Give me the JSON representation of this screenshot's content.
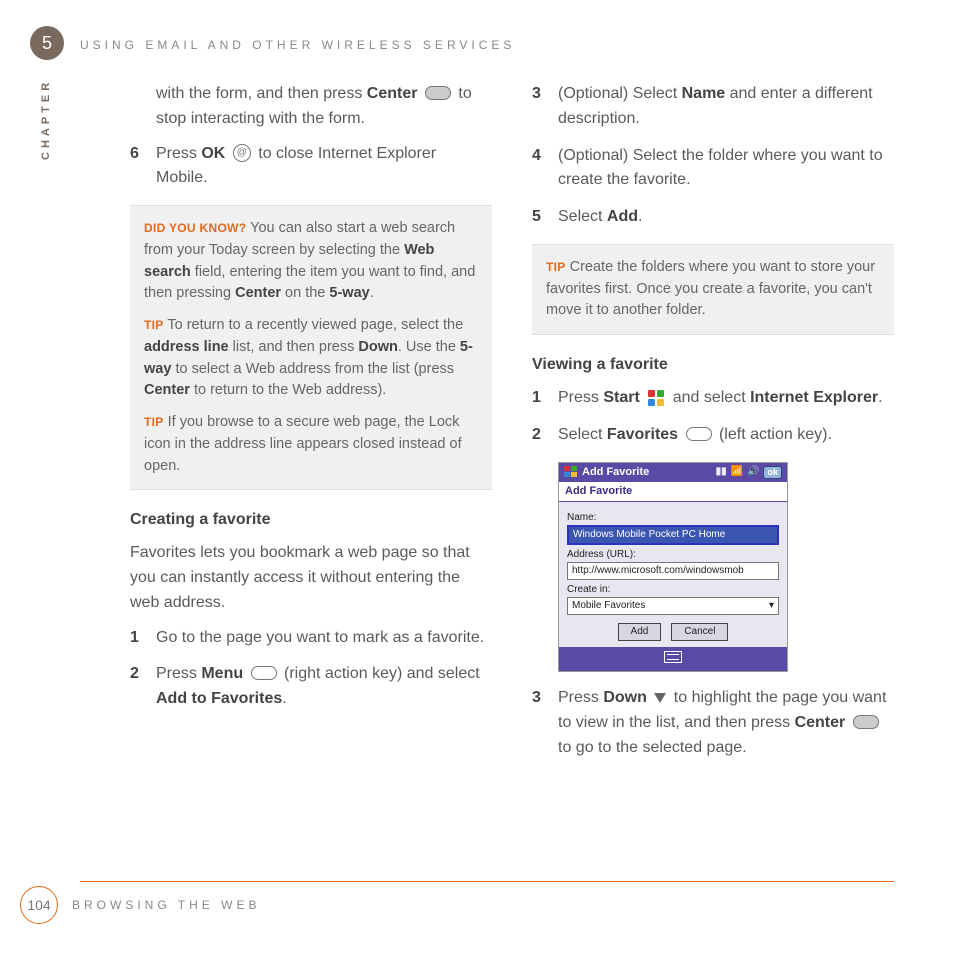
{
  "chapter": {
    "number": "5",
    "label": "CHAPTER"
  },
  "runningHeader": "USING EMAIL AND OTHER WIRELESS SERVICES",
  "left": {
    "intro_a": "with the form, and then press ",
    "intro_b": "Center",
    "intro_c": " to stop interacting with the form.",
    "step6_a": "Press ",
    "step6_b": "OK",
    "step6_c": " to close Internet Explorer Mobile.",
    "dyk_label": "DID YOU KNOW?",
    "dyk_body_a": " You can also start a web search from your Today screen by selecting the ",
    "dyk_body_b": "Web search",
    "dyk_body_c": " field, entering the item you want to find, and then pressing ",
    "dyk_body_d": "Center",
    "dyk_body_e": " on the ",
    "dyk_body_f": "5-way",
    "dyk_body_g": ".",
    "tip1_label": "TIP",
    "tip1_a": " To return to a recently viewed page, select the ",
    "tip1_b": "address line",
    "tip1_c": " list, and then press ",
    "tip1_d": "Down",
    "tip1_e": ". Use the ",
    "tip1_f": "5-way",
    "tip1_g": " to select a Web address from the list (press ",
    "tip1_h": "Center",
    "tip1_i": " to return to the Web address).",
    "tip2_label": "TIP",
    "tip2": " If you browse to a secure web page, the Lock icon in the address line appears closed instead of open.",
    "h_creating": "Creating a favorite",
    "creating_intro": "Favorites lets you bookmark a web page so that you can instantly access it without entering the web address.",
    "c_step1": "Go to the page you want to mark as a favorite.",
    "c_step2_a": "Press ",
    "c_step2_b": "Menu",
    "c_step2_c": " (right action key) and select ",
    "c_step2_d": "Add to Favorites",
    "c_step2_e": "."
  },
  "right": {
    "step3_a": "(Optional) Select ",
    "step3_b": "Name",
    "step3_c": " and enter a different description.",
    "step4": "(Optional) Select the folder where you want to create the favorite.",
    "step5_a": "Select ",
    "step5_b": "Add",
    "step5_c": ".",
    "tip_label": "TIP",
    "tip_body": " Create the folders where you want to store your favorites first. Once you create a favorite, you can't move it to another folder.",
    "h_viewing": "Viewing a favorite",
    "v_step1_a": "Press ",
    "v_step1_b": "Start",
    "v_step1_c": " and select ",
    "v_step1_d": "Internet Explorer",
    "v_step1_e": ".",
    "v_step2_a": "Select ",
    "v_step2_b": "Favorites",
    "v_step2_c": " (left action key).",
    "v_step3_a": "Press ",
    "v_step3_b": "Down",
    "v_step3_c": " to highlight the page you want to view in the list, and then press ",
    "v_step3_d": "Center",
    "v_step3_e": " to go to the selected page."
  },
  "screenshot": {
    "title": "Add Favorite",
    "subtitle": "Add Favorite",
    "ok": "ok",
    "name_lbl": "Name:",
    "name_val": "Windows Mobile Pocket PC Home",
    "addr_lbl": "Address (URL):",
    "addr_val": "http://www.microsoft.com/windowsmob",
    "create_lbl": "Create in:",
    "create_val": "Mobile Favorites",
    "btn_add": "Add",
    "btn_cancel": "Cancel"
  },
  "footer": {
    "pageNum": "104",
    "section": "BROWSING THE WEB"
  }
}
